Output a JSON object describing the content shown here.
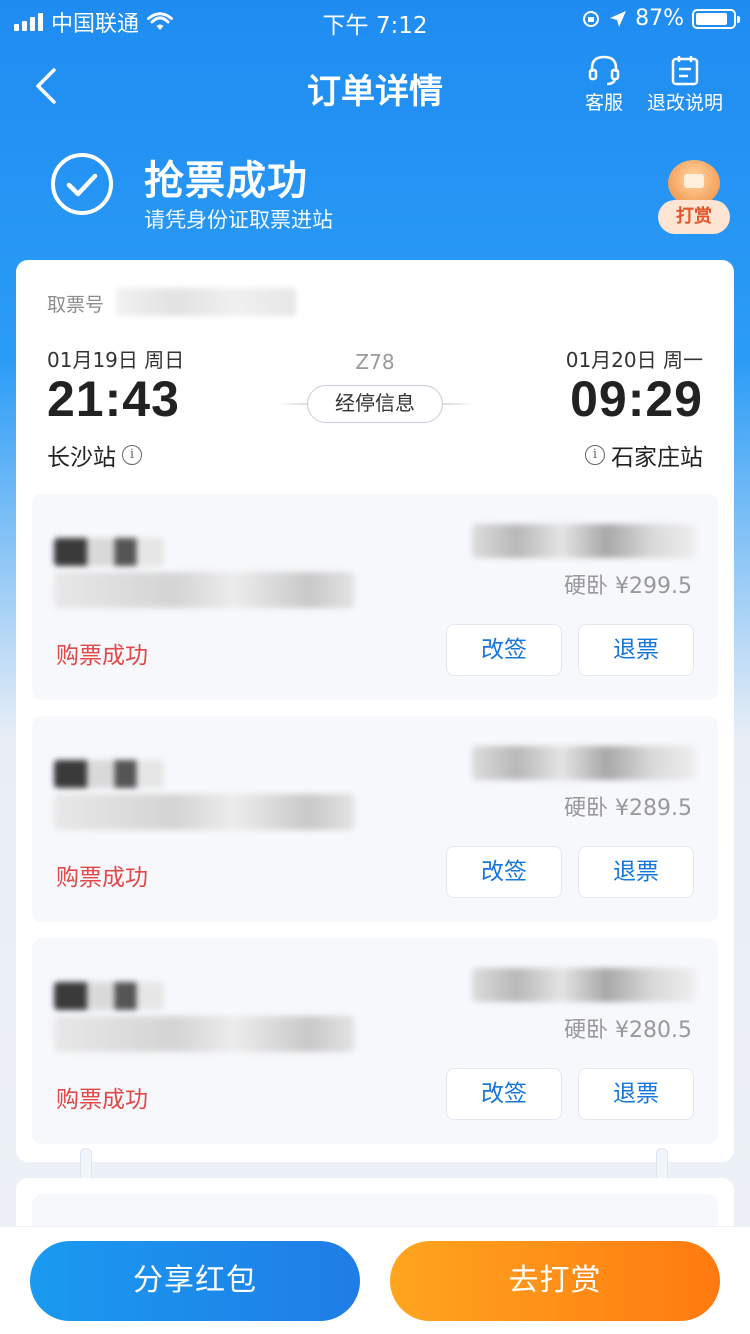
{
  "status_bar": {
    "carrier": "中国联通",
    "time": "下午 7:12",
    "battery_text": "87%",
    "battery_level": 0.87
  },
  "nav": {
    "title": "订单详情",
    "service_label": "客服",
    "refund_rules_label": "退改说明"
  },
  "success": {
    "title": "抢票成功",
    "subtitle": "请凭身份证取票进站",
    "tip_badge": "打赏"
  },
  "ticket": {
    "pickup_label": "取票号",
    "train_no": "Z78",
    "stop_info_label": "经停信息",
    "departure": {
      "date": "01月19日  周日",
      "time": "21:43",
      "station": "长沙站"
    },
    "arrival": {
      "date": "01月20日  周一",
      "time": "09:29",
      "station": "石家庄站"
    }
  },
  "passengers": [
    {
      "seat_price": "硬卧 ¥299.5",
      "status": "购票成功",
      "change_label": "改签",
      "refund_label": "退票"
    },
    {
      "seat_price": "硬卧 ¥289.5",
      "status": "购票成功",
      "change_label": "改签",
      "refund_label": "退票"
    },
    {
      "seat_price": "硬卧 ¥280.5",
      "status": "购票成功",
      "change_label": "改签",
      "refund_label": "退票"
    }
  ],
  "bottom": {
    "share_label": "分享红包",
    "tip_label": "去打赏"
  },
  "colors": {
    "primary_blue": "#1f8cf2",
    "success_red": "#e14848",
    "action_blue": "#1677d9",
    "tip_orange": "#ff7a10"
  }
}
